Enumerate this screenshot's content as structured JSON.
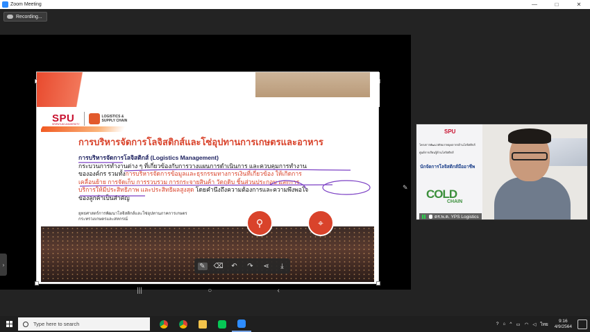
{
  "window": {
    "title": "Zoom Meeting",
    "controls": [
      "—",
      "□",
      "✕"
    ]
  },
  "recording": {
    "label": "Recording..."
  },
  "slide": {
    "logo_spu": "SPU",
    "logo_spu_sub": "SRIPATUM UNIVERSITY",
    "logo_ls_line1": "LOGISTICS &",
    "logo_ls_line2": "SUPPLY CHAIN",
    "title": "การบริหารจัดการโลจิสติกส์และโซ่อุปทานการเกษตรและอาหาร",
    "heading": "การบริหารจัดการโลจิสติกส์ (Logistics Management)",
    "line1": "กระบวนการทำงานต่าง ๆ ที่เกี่ยวข้องกับการวางแผนการดำเนินการ และควบคุมการทำงาน",
    "line2a": "ขององค์กร รวมทั้ง",
    "line2b": "การบริหารจัดการข้อมูลและธุรกรรมทางการเงินที่เกี่ยวข้อง ให้เกิดการ",
    "line3": "เคลื่อนย้าย การจัดเก็บ การรวบรวม การกระจายสินค้า วัตถุดิบ ชิ้นส่วนประกอบ และการ",
    "line4a": "บริการให้มีประสิทธิภาพ และประสิทธิผลสูงสุด",
    "line4b": " โดยคำนึงถึงความต้องการและความพึงพอใจ",
    "line5": "ของลูกค้าเป็นสำคัญ",
    "footnote1": "ยุทธศาสตร์การพัฒนาโลจิสติกส์และโซ่อุปทานภาคการเกษตร",
    "footnote2": "กระทรวงเกษตรและสหกรณ์"
  },
  "annotation_toolbar": {
    "tools": [
      "✎",
      "⌫",
      "↶",
      "↷",
      "⋖",
      "⤓"
    ]
  },
  "nav": {
    "buttons": [
      "|||",
      "○",
      "‹"
    ]
  },
  "video": {
    "logo": "SPU",
    "small1": "โครงการพัฒนาศักยภาพบุคลากรด้านโลจิสติกส์",
    "small2": "ศูนย์การเรียนรู้ด้านโลจิสติกส์",
    "title": "นักจัดการโลจิสติกส์มืออาชีพ",
    "cold": "COLD",
    "chain": "CHAIN",
    "participant_name": "ดร.พ.ค. YPS Logistics"
  },
  "taskbar": {
    "search_placeholder": "Type here to search",
    "lang": "ไทย",
    "time": "9:16",
    "date": "4/9/2564"
  }
}
